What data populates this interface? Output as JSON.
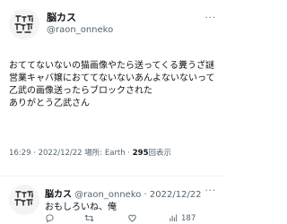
{
  "tweet": {
    "display_name": "脳カス",
    "handle": "@raon_onneko",
    "more_label": "···",
    "text": "おててないないの猫画像やたら送ってくる糞うざ謎\n営業キャバ嬢におててないないあんよないないって\n乙武の画像送ったらブロックされた\nありがとう乙武さん",
    "meta": {
      "time_date": "16:29 · 2022/12/22 場所: Earth · ",
      "views_count": "295",
      "views_label": "回表示"
    }
  },
  "reply": {
    "display_name": "脳カス",
    "handle_date": " @raon_onneko · 2022/12/22",
    "more_label": "···",
    "text": "おもしろいね、俺",
    "actions": {
      "reply_count": "",
      "retweet_count": "",
      "like_count": "",
      "views_count": "187"
    }
  },
  "icons": [
    "avatar-image",
    "more-icon",
    "reply-icon",
    "retweet-icon",
    "like-icon",
    "views-icon"
  ],
  "colors": {
    "text": "#0f1419",
    "secondary": "#536471",
    "divider": "#eff3f4"
  }
}
